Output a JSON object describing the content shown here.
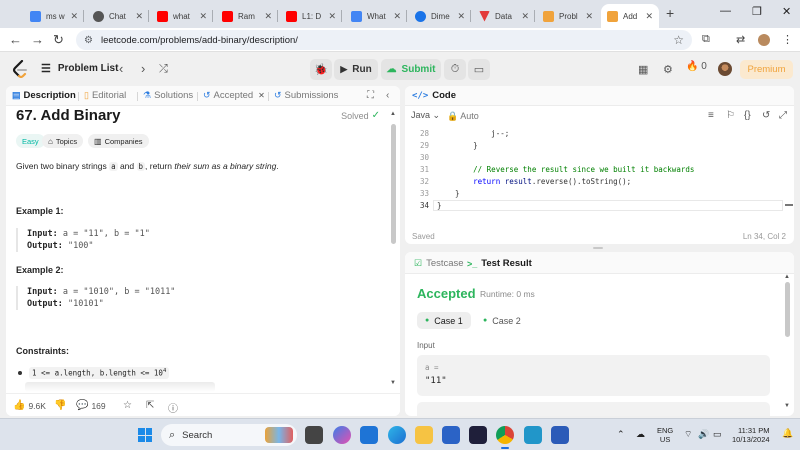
{
  "browser": {
    "tabs": [
      {
        "title": "ms w",
        "color": "#4285f4",
        "active": false
      },
      {
        "title": "Chat",
        "color": "#555555",
        "active": false
      },
      {
        "title": "what",
        "color": "#ff0000",
        "active": false
      },
      {
        "title": "Ram",
        "color": "#ff0000",
        "active": false
      },
      {
        "title": "L1: D",
        "color": "#ff0000",
        "active": false
      },
      {
        "title": "What",
        "color": "#4285f4",
        "active": false
      },
      {
        "title": "Dime",
        "color": "#1a73e8",
        "active": false
      },
      {
        "title": "Data",
        "color": "#e33b3b",
        "active": false
      },
      {
        "title": "Probl",
        "color": "#f0a33c",
        "active": false
      },
      {
        "title": "Add",
        "color": "#f0a33c",
        "active": true
      }
    ],
    "url": "leetcode.com/problems/add-binary/description/"
  },
  "header": {
    "problem_list": "Problem List",
    "run": "Run",
    "submit": "Submit",
    "streak": "0",
    "premium": "Premium"
  },
  "description_panel": {
    "tabs": [
      "Description",
      "Editorial",
      "Solutions",
      "Accepted",
      "Submissions"
    ],
    "title": "67. Add Binary",
    "status": "Solved",
    "chips": [
      "Easy",
      "Topics",
      "Companies"
    ],
    "statement": {
      "p1": "Given two binary strings ",
      "a": "a",
      "p2": " and ",
      "b": "b",
      "p3": ", return ",
      "em": "their sum as a binary string",
      "p4": "."
    },
    "examples": [
      {
        "title": "Example 1:",
        "input_label": "Input:",
        "input": "a = \"11\", b = \"1\"",
        "output_label": "Output:",
        "output": "\"100\""
      },
      {
        "title": "Example 2:",
        "input_label": "Input:",
        "input": "a = \"1010\", b = \"1011\"",
        "output_label": "Output:",
        "output": "\"10101\""
      }
    ],
    "constraints_title": "Constraints:",
    "constraint_1": "1 <= a.length, b.length <= 10",
    "constraint_1_exp": "4",
    "footer": {
      "likes": "9.6K",
      "comments": "169"
    }
  },
  "code_panel": {
    "title": "Code",
    "language": "Java",
    "mode": "Auto",
    "lines": [
      {
        "n": "28",
        "text": "            j--;",
        "kind": "plain"
      },
      {
        "n": "29",
        "text": "        }",
        "kind": "plain"
      },
      {
        "n": "30",
        "text": "",
        "kind": "plain"
      },
      {
        "n": "31",
        "text": "        // Reverse the result since we built it backwards",
        "kind": "comment"
      },
      {
        "n": "32",
        "text": "        return result.reverse().toString();",
        "kind": "return"
      },
      {
        "n": "33",
        "text": "    }",
        "kind": "plain"
      },
      {
        "n": "34",
        "text": "}",
        "kind": "plain"
      }
    ],
    "saved": "Saved",
    "cursor_pos": "Ln 34, Col 2"
  },
  "result_panel": {
    "tabs": [
      "Testcase",
      "Test Result"
    ],
    "verdict": "Accepted",
    "runtime": "Runtime: 0 ms",
    "cases": [
      "Case 1",
      "Case 2"
    ],
    "input_label": "Input",
    "var_name": "a =",
    "var_value": "\"11\""
  },
  "taskbar": {
    "search": "Search",
    "lang_1": "ENG",
    "lang_2": "US",
    "time": "11:31 PM",
    "date": "10/13/2024"
  },
  "colors": {
    "accent_green": "#2db55d",
    "easy": "#00b8a3",
    "premium": "#f0a33c"
  }
}
